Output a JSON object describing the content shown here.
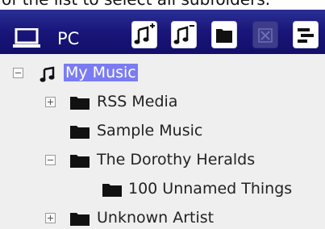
{
  "top_text": "of the list to select all subfolders.",
  "toolbar": {
    "pc_icon": "laptop-icon",
    "pc_label": "PC",
    "buttons": [
      {
        "name": "add-music-folder-icon",
        "enabled": true
      },
      {
        "name": "remove-music-folder-icon",
        "enabled": true
      },
      {
        "name": "folder-icon",
        "enabled": true
      },
      {
        "name": "delete-x-icon",
        "enabled": false
      },
      {
        "name": "menu-lines-icon",
        "enabled": true
      }
    ],
    "colors": {
      "bar": "#19157a",
      "selected": "#7b7cf2",
      "tree_bg": "#efefef"
    }
  },
  "tree": {
    "root": {
      "label": "My Music",
      "icon": "music-note-icon",
      "expanded": true,
      "selected": true
    },
    "items": [
      {
        "label": "RSS Media",
        "icon": "folder-icon",
        "toggle": "plus"
      },
      {
        "label": "Sample Music",
        "icon": "folder-icon",
        "toggle": "none"
      },
      {
        "label": "The Dorothy Heralds",
        "icon": "folder-icon",
        "toggle": "minus"
      },
      {
        "label": "100 Unnamed Things",
        "icon": "folder-icon",
        "toggle": "none"
      },
      {
        "label": "Unknown Artist",
        "icon": "folder-icon",
        "toggle": "plus"
      }
    ]
  }
}
